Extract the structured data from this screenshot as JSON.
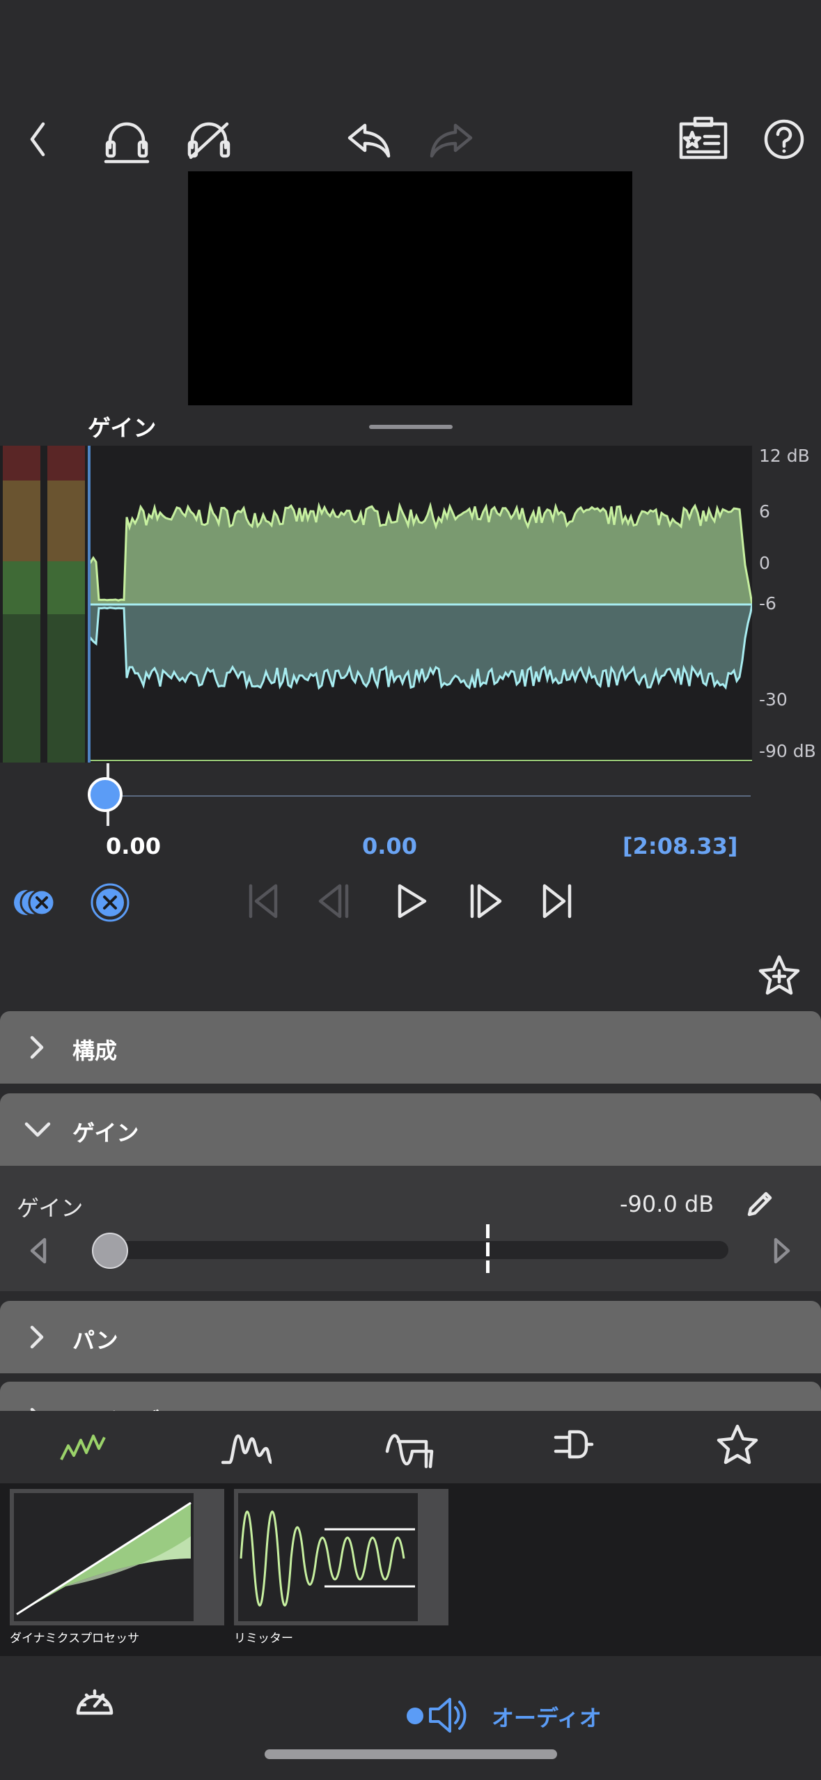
{
  "panel": {
    "title": "ゲイン"
  },
  "db_scale": [
    "12 dB",
    "6",
    "0",
    "-6",
    "-30",
    "-90 dB"
  ],
  "transport": {
    "position_left": "0.00",
    "position_center": "0.00",
    "duration": "[2:08.33]"
  },
  "sections": {
    "composition": "構成",
    "gain": "ゲイン",
    "pan": "パン",
    "reverb_partial": "リバーブ EQ"
  },
  "gain_control": {
    "label": "ゲイン",
    "value": "-90.0 dB",
    "level_fraction": 0.0
  },
  "presets": [
    {
      "label": "ダイナミクスプロセッサ"
    },
    {
      "label": "リミッター"
    }
  ],
  "bottom": {
    "audio_label": "オーディオ"
  },
  "colors": {
    "accent": "#5b9cf6",
    "wave_green": "#c7f0a0",
    "wave_cyan": "#a8ecf0"
  }
}
